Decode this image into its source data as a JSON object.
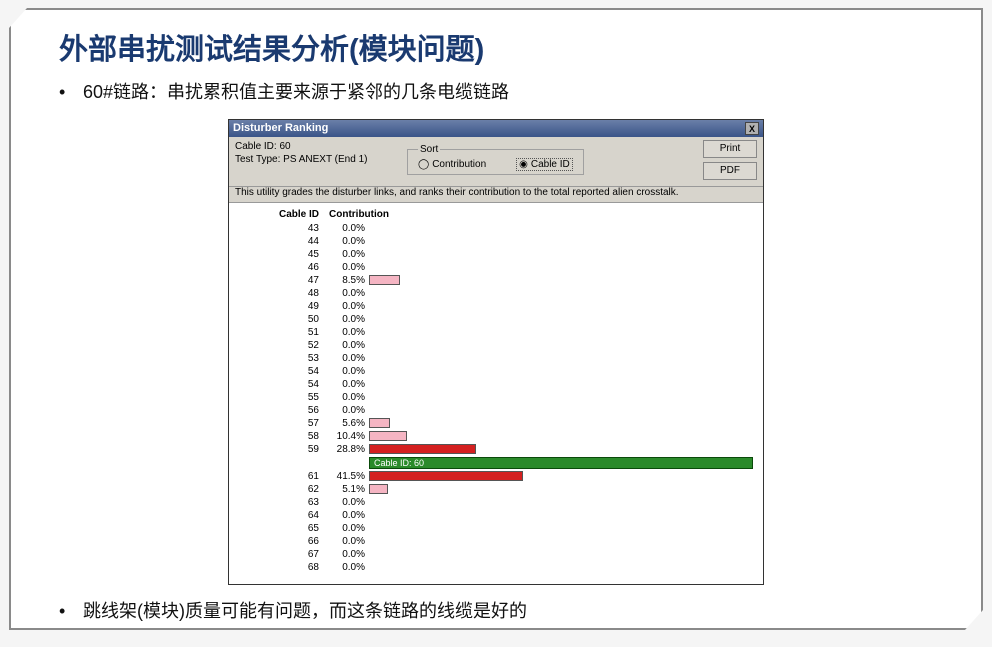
{
  "title": "外部串扰测试结果分析(模块问题)",
  "bullet_top": "60#链路：串扰累积值主要来源于紧邻的几条电缆链路",
  "bullet_bottom": "跳线架(模块)质量可能有问题，而这条链路的线缆是好的",
  "window": {
    "title": "Disturber Ranking",
    "close": "X",
    "cable_label": "Cable ID: 60",
    "test_label": "Test Type: PS ANEXT (End 1)",
    "sort_legend": "Sort",
    "sort_contribution": "Contribution",
    "sort_cableid": "Cable ID",
    "print": "Print",
    "pdf": "PDF",
    "description": "This utility grades the disturber links, and ranks their contribution to the total reported alien crosstalk.",
    "col_cable": "Cable ID",
    "col_contrib": "Contribution",
    "self_label": "Cable ID: 60"
  },
  "chart_data": {
    "type": "bar",
    "title": "Disturber Ranking",
    "xlabel": "Contribution",
    "ylabel": "Cable ID",
    "xlim": [
      0,
      100
    ],
    "self_cable": 60,
    "series": [
      {
        "cable_id": 43,
        "contribution_pct": 0.0
      },
      {
        "cable_id": 44,
        "contribution_pct": 0.0
      },
      {
        "cable_id": 45,
        "contribution_pct": 0.0
      },
      {
        "cable_id": 46,
        "contribution_pct": 0.0
      },
      {
        "cable_id": 47,
        "contribution_pct": 8.5
      },
      {
        "cable_id": 48,
        "contribution_pct": 0.0
      },
      {
        "cable_id": 49,
        "contribution_pct": 0.0
      },
      {
        "cable_id": 50,
        "contribution_pct": 0.0
      },
      {
        "cable_id": 51,
        "contribution_pct": 0.0
      },
      {
        "cable_id": 52,
        "contribution_pct": 0.0
      },
      {
        "cable_id": 53,
        "contribution_pct": 0.0
      },
      {
        "cable_id": 54,
        "contribution_pct": 0.0
      },
      {
        "cable_id": 54,
        "contribution_pct": 0.0
      },
      {
        "cable_id": 55,
        "contribution_pct": 0.0
      },
      {
        "cable_id": 56,
        "contribution_pct": 0.0
      },
      {
        "cable_id": 57,
        "contribution_pct": 5.6
      },
      {
        "cable_id": 58,
        "contribution_pct": 10.4
      },
      {
        "cable_id": 59,
        "contribution_pct": 28.8
      },
      {
        "cable_id": 60,
        "contribution_pct": null,
        "is_self": true
      },
      {
        "cable_id": 61,
        "contribution_pct": 41.5
      },
      {
        "cable_id": 62,
        "contribution_pct": 5.1
      },
      {
        "cable_id": 63,
        "contribution_pct": 0.0
      },
      {
        "cable_id": 64,
        "contribution_pct": 0.0
      },
      {
        "cable_id": 65,
        "contribution_pct": 0.0
      },
      {
        "cable_id": 66,
        "contribution_pct": 0.0
      },
      {
        "cable_id": 67,
        "contribution_pct": 0.0
      },
      {
        "cable_id": 68,
        "contribution_pct": 0.0
      }
    ]
  }
}
